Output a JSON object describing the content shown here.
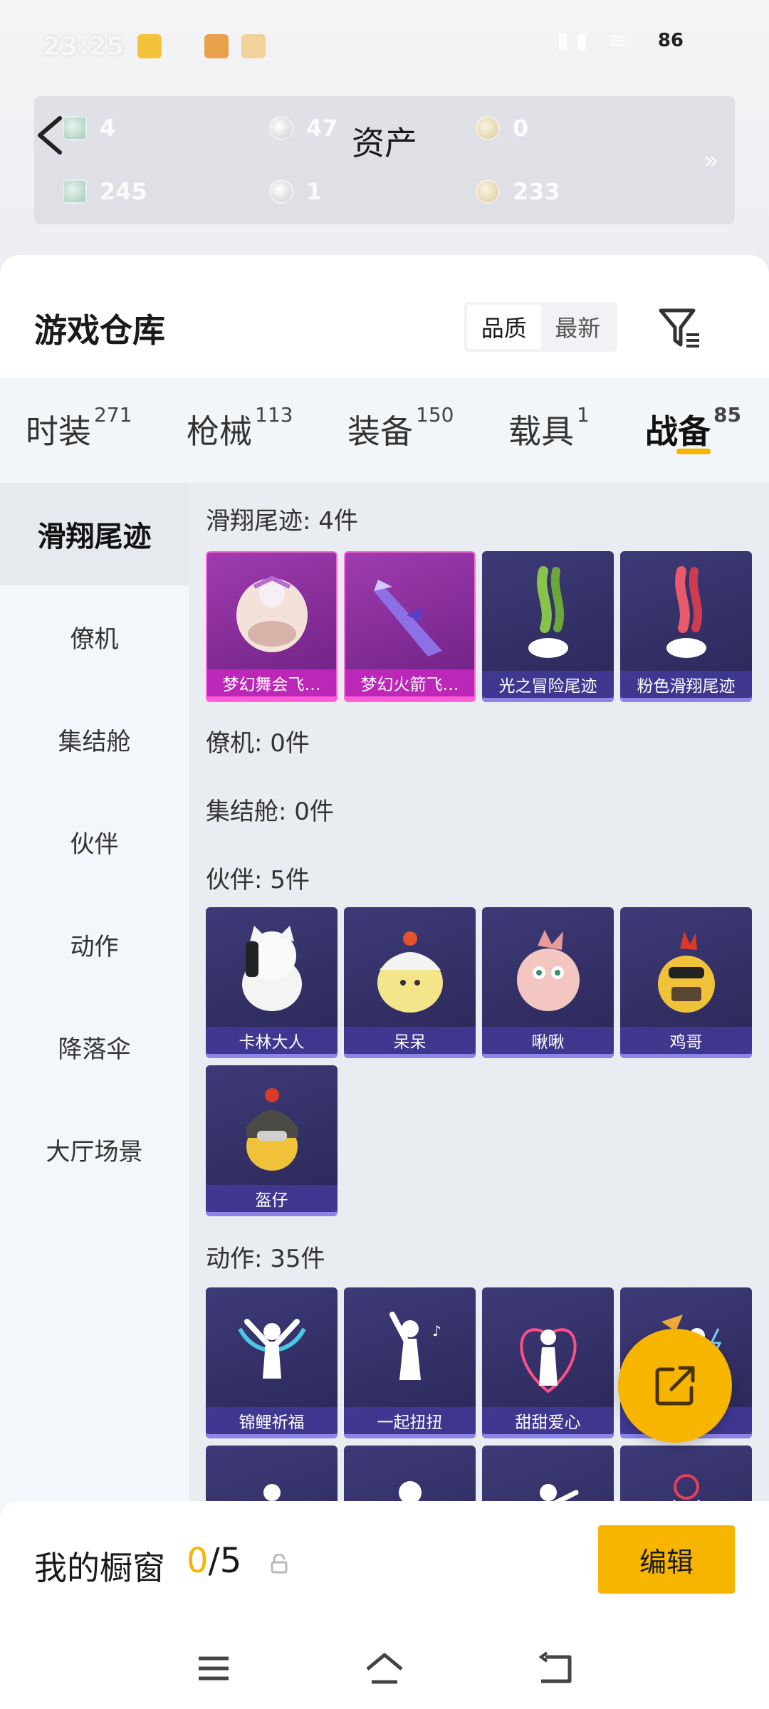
{
  "status_bar": {
    "time": "23:25",
    "battery": "86"
  },
  "assets": {
    "title": "资产",
    "items": [
      {
        "value": "4",
        "icon": "green-ticket-coin"
      },
      {
        "value": "47",
        "icon": "silver-coin"
      },
      {
        "value": "0",
        "icon": "gold-coin"
      },
      {
        "value": "245",
        "icon": "green-ticket-coin"
      },
      {
        "value": "1",
        "icon": "silver-coin"
      },
      {
        "value": "233",
        "icon": "gold-coin"
      }
    ]
  },
  "warehouse": {
    "title": "游戏仓库",
    "sort_options": [
      "品质",
      "最新"
    ],
    "active_sort": "品质"
  },
  "categories": [
    {
      "label": "时装",
      "count": "271"
    },
    {
      "label": "枪械",
      "count": "113"
    },
    {
      "label": "装备",
      "count": "150"
    },
    {
      "label": "载具",
      "count": "1"
    },
    {
      "label": "战备",
      "count": "85"
    }
  ],
  "active_category": "战备",
  "sidebar": [
    "滑翔尾迹",
    "僚机",
    "集结舱",
    "伙伴",
    "动作",
    "降落伞",
    "大厅场景"
  ],
  "active_sidebar": "滑翔尾迹",
  "sections": [
    {
      "title": "滑翔尾迹: 4件",
      "items": [
        "梦幻舞会飞…",
        "梦幻火箭飞…",
        "光之冒险尾迹",
        "粉色滑翔尾迹"
      ]
    },
    {
      "title": "僚机: 0件",
      "items": []
    },
    {
      "title": "集结舱: 0件",
      "items": []
    },
    {
      "title": "伙伴: 5件",
      "items": [
        "卡林大人",
        "呆呆",
        "啾啾",
        "鸡哥",
        "盔仔"
      ]
    },
    {
      "title": "动作: 35件",
      "items": [
        "锦鲤祈福",
        "一起扭扭",
        "甜甜爱心",
        ""
      ]
    }
  ],
  "showcase": {
    "label": "我的橱窗",
    "current": "0",
    "total": "/5",
    "edit_label": "编辑"
  },
  "colors": {
    "accent": "#f7b500",
    "tile_purple": "#2f2b63",
    "tile_pink": "#a03bb0"
  }
}
